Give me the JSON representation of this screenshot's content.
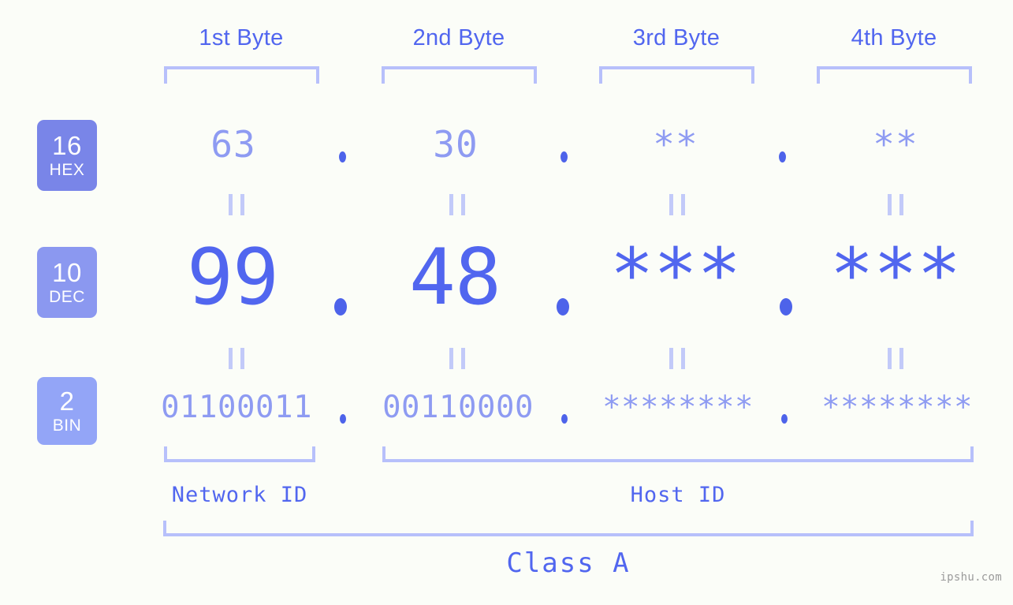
{
  "background_color": "#fbfdf8",
  "accent_color": "#5166ef",
  "accent_light_color": "#8e9bf2",
  "bracket_color": "#b7c0fb",
  "byte_headers": [
    {
      "label": "1st Byte"
    },
    {
      "label": "2nd Byte"
    },
    {
      "label": "3rd Byte"
    },
    {
      "label": "4th Byte"
    }
  ],
  "bases": [
    {
      "number": "16",
      "name": "HEX",
      "color": "#7985e8"
    },
    {
      "number": "10",
      "name": "DEC",
      "color": "#8b98f0"
    },
    {
      "number": "2",
      "name": "BIN",
      "color": "#93a5f7"
    }
  ],
  "rows": {
    "hex": {
      "base_number": "16",
      "base_name": "HEX",
      "octets": [
        "63",
        "30",
        "**",
        "**"
      ],
      "separator": "."
    },
    "dec": {
      "base_number": "10",
      "base_name": "DEC",
      "octets": [
        "99",
        "48",
        "***",
        "***"
      ],
      "separator": "."
    },
    "bin": {
      "base_number": "2",
      "base_name": "BIN",
      "octets": [
        "01100011",
        "00110000",
        "********",
        "********"
      ],
      "separator": "."
    }
  },
  "equality_symbol": "||",
  "segments": {
    "network_id": "Network ID",
    "host_id": "Host ID"
  },
  "class_label": "Class A",
  "watermark": "ipshu.com"
}
